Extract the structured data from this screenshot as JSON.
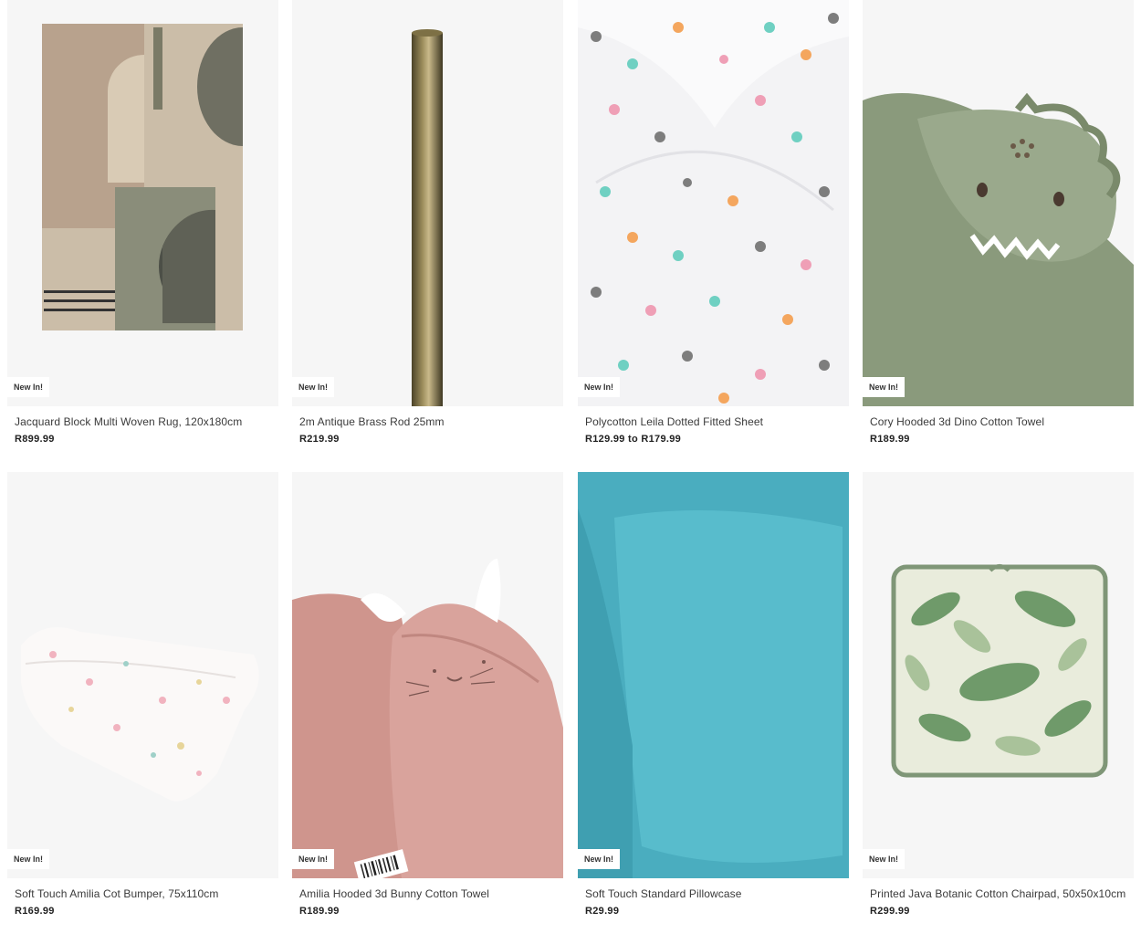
{
  "products": [
    {
      "name": "Jacquard Block Multi Woven Rug, 120x180cm",
      "price": "R899.99",
      "badge": "New In!",
      "image_icon": "rug-image"
    },
    {
      "name": "2m Antique Brass Rod 25mm",
      "price": "R219.99",
      "badge": "New In!",
      "image_icon": "curtain-rod-image"
    },
    {
      "name": "Polycotton Leila Dotted Fitted Sheet",
      "price": "R129.99 to R179.99",
      "badge": "New In!",
      "image_icon": "dotted-sheet-image"
    },
    {
      "name": "Cory Hooded 3d Dino Cotton Towel",
      "price": "R189.99",
      "badge": "New In!",
      "image_icon": "dino-towel-image"
    },
    {
      "name": "Soft Touch Amilia Cot Bumper, 75x110cm",
      "price": "R169.99",
      "badge": "New In!",
      "image_icon": "cot-bumper-image"
    },
    {
      "name": "Amilia Hooded 3d Bunny Cotton Towel",
      "price": "R189.99",
      "badge": "New In!",
      "image_icon": "bunny-towel-image"
    },
    {
      "name": "Soft Touch Standard Pillowcase",
      "price": "R29.99",
      "badge": "New In!",
      "image_icon": "pillowcase-image"
    },
    {
      "name": "Printed Java Botanic Cotton Chairpad, 50x50x10cm",
      "price": "R299.99",
      "badge": "New In!",
      "image_icon": "chairpad-image"
    }
  ],
  "colors": {
    "image_bg": "#f6f6f6",
    "pillow_blue": "#4fb3c4",
    "towel_green": "#8a9a7c",
    "towel_pink": "#d9a39c"
  }
}
